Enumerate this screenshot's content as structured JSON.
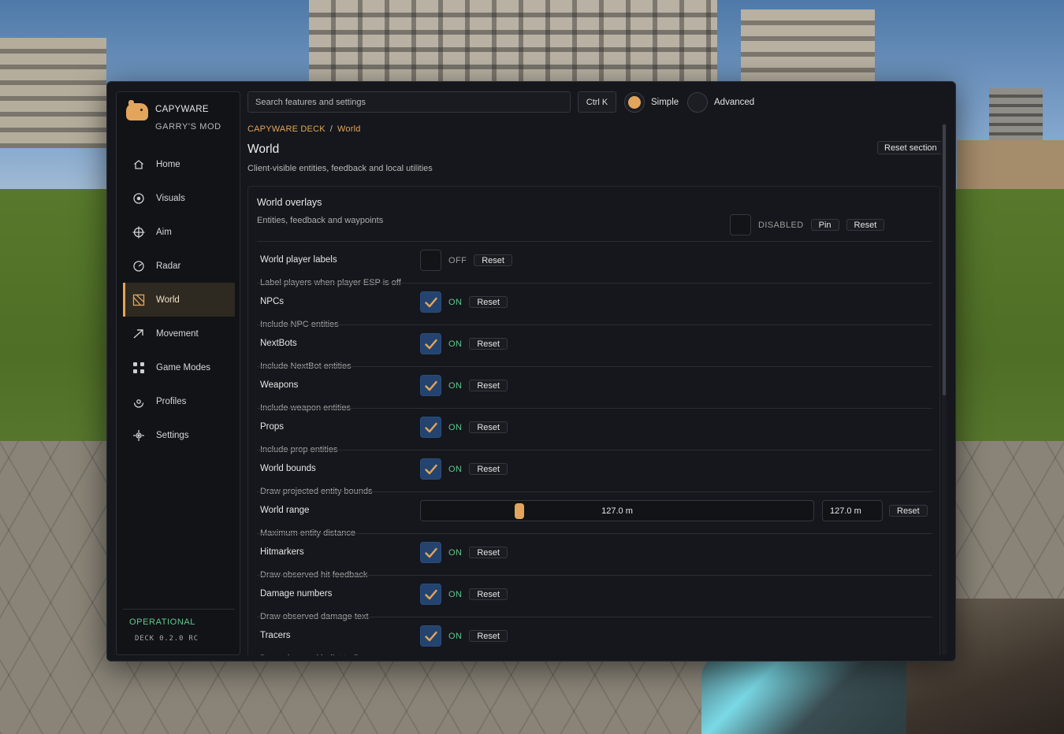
{
  "brand": {
    "name": "CAPYWARE",
    "subtitle": "GARRY'S MOD"
  },
  "nav": [
    {
      "label": "Home",
      "icon": "home-icon",
      "active": false
    },
    {
      "label": "Visuals",
      "icon": "eye-icon",
      "active": false
    },
    {
      "label": "Aim",
      "icon": "crosshair-icon",
      "active": false
    },
    {
      "label": "Radar",
      "icon": "radar-icon",
      "active": false
    },
    {
      "label": "World",
      "icon": "world-icon",
      "active": true
    },
    {
      "label": "Movement",
      "icon": "arrow-icon",
      "active": false
    },
    {
      "label": "Game Modes",
      "icon": "grid-icon",
      "active": false
    },
    {
      "label": "Profiles",
      "icon": "profile-icon",
      "active": false
    },
    {
      "label": "Settings",
      "icon": "gear-icon",
      "active": false
    }
  ],
  "status": {
    "state": "OPERATIONAL",
    "version": "DECK 0.2.0 RC"
  },
  "topbar": {
    "search_placeholder": "Search features and settings",
    "shortcut": "Ctrl K",
    "mode_simple": "Simple",
    "mode_advanced": "Advanced",
    "selected_mode": "Simple"
  },
  "breadcrumb": {
    "root": "CAPYWARE DECK",
    "separator": "/",
    "current": "World"
  },
  "page": {
    "title": "World",
    "description": "Client-visible entities, feedback and local utilities",
    "reset_section": "Reset section"
  },
  "panel": {
    "title": "World overlays",
    "description": "Entities, feedback and waypoints",
    "enabled": false,
    "state_label": "DISABLED",
    "pin_label": "Pin",
    "reset_label": "Reset"
  },
  "settings": [
    {
      "label": "World player labels",
      "hint": "Label players when player ESP is off",
      "type": "toggle",
      "checked": false,
      "state": "OFF",
      "reset": "Reset"
    },
    {
      "label": "NPCs",
      "hint": "Include NPC entities",
      "type": "toggle",
      "checked": true,
      "state": "ON",
      "reset": "Reset"
    },
    {
      "label": "NextBots",
      "hint": "Include NextBot entities",
      "type": "toggle",
      "checked": true,
      "state": "ON",
      "reset": "Reset"
    },
    {
      "label": "Weapons",
      "hint": "Include weapon entities",
      "type": "toggle",
      "checked": true,
      "state": "ON",
      "reset": "Reset"
    },
    {
      "label": "Props",
      "hint": "Include prop entities",
      "type": "toggle",
      "checked": true,
      "state": "ON",
      "reset": "Reset"
    },
    {
      "label": "World bounds",
      "hint": "Draw projected entity bounds",
      "type": "toggle",
      "checked": true,
      "state": "ON",
      "reset": "Reset"
    },
    {
      "label": "World range",
      "hint": "Maximum entity distance",
      "type": "slider",
      "value_text": "127.0 m",
      "input_value": "127.0 m",
      "fraction": 0.25,
      "reset": "Reset"
    },
    {
      "label": "Hitmarkers",
      "hint": "Draw observed hit feedback",
      "type": "toggle",
      "checked": true,
      "state": "ON",
      "reset": "Reset"
    },
    {
      "label": "Damage numbers",
      "hint": "Draw observed damage text",
      "type": "toggle",
      "checked": true,
      "state": "ON",
      "reset": "Reset"
    },
    {
      "label": "Tracers",
      "hint": "Draw observed bullet trails",
      "type": "toggle",
      "checked": true,
      "state": "ON",
      "reset": "Reset"
    }
  ],
  "colors": {
    "accent": "#e3a55c",
    "on": "#5fc98d",
    "checkbox": "#24436e",
    "bg": "#15171c"
  }
}
